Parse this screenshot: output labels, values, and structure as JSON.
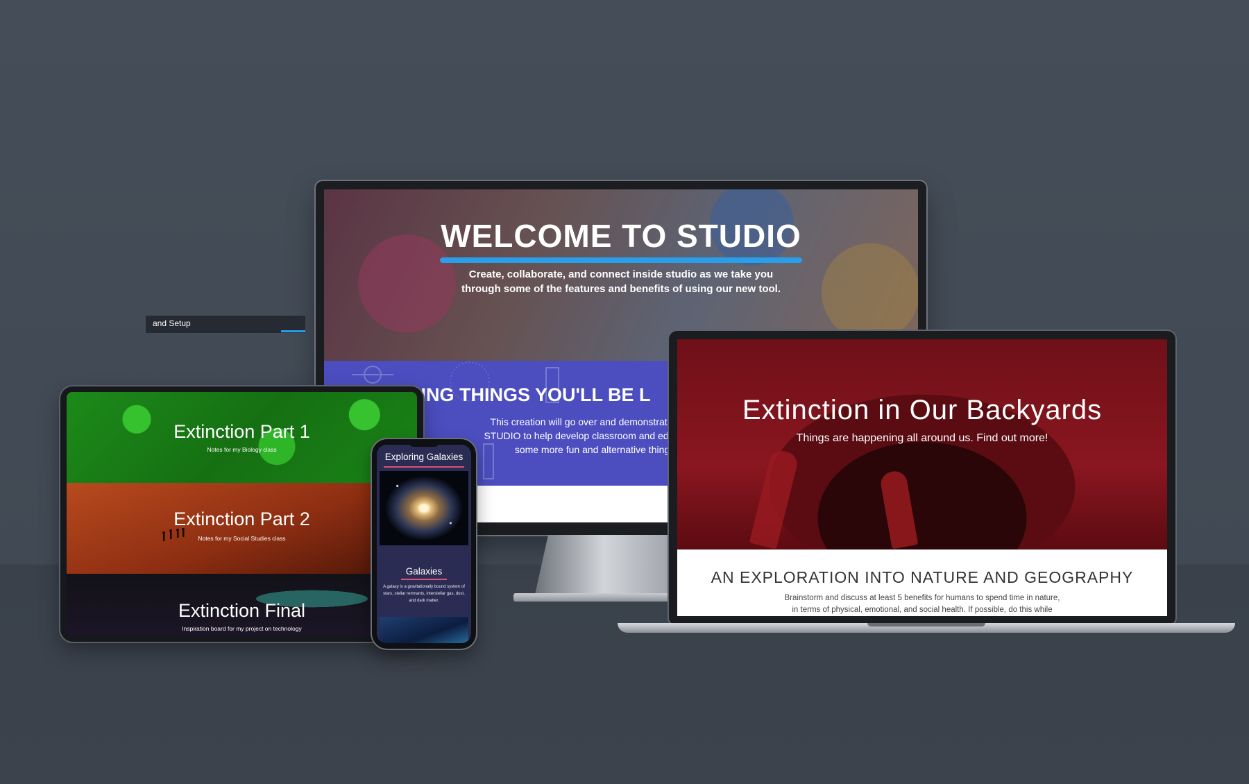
{
  "monitor": {
    "hero_title": "WELCOME TO STUDIO",
    "hero_subtitle_line1": "Create, collaborate, and connect inside studio as we take you",
    "hero_subtitle_line2": "through some of the features and benefits of using our new tool.",
    "section_title": "HING THINGS YOU'LL BE L",
    "section_body_line1": "This creation will go over and demonstrate some",
    "section_body_line2": "STUDIO to help develop classroom and educationa",
    "section_body_line3": "some more fun and alternative things",
    "dark_bar_label": "and Setup"
  },
  "laptop": {
    "hero_title": "Extinction in Our Backyards",
    "hero_subtitle": "Things are happening all around us. Find out more!",
    "section_heading": "AN EXPLORATION INTO NATURE AND GEOGRAPHY",
    "body_line1": "Brainstorm and discuss at least 5 benefits for humans to spend time in nature,",
    "body_line2": "in terms of physical, emotional, and social health. If possible, do this while"
  },
  "tablet": {
    "rows": [
      {
        "title": "Extinction Part 1",
        "subtitle": "Notes for my Biology class"
      },
      {
        "title": "Extinction Part 2",
        "subtitle": "Notes for my Social Studies class"
      },
      {
        "title": "Extinction Final",
        "subtitle": "Inspiration board for my project on technology"
      }
    ]
  },
  "phone": {
    "title": "Exploring Galaxies",
    "section_title": "Galaxies",
    "section_body": "A galaxy is a gravitationally bound system of stars, stellar remnants, interstellar gas, dust, and dark matter."
  },
  "colors": {
    "background": "#434b56",
    "accent_blue": "#2a9ee8",
    "section_purple": "#4c4ec0",
    "laptop_red": "#7d121c",
    "phone_accent": "#d9527a"
  }
}
